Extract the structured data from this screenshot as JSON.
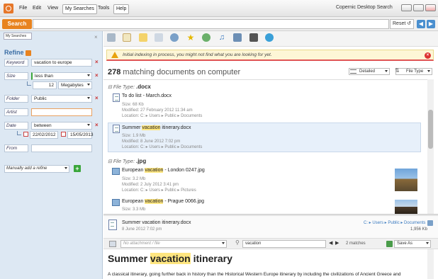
{
  "menu": {
    "file": "File",
    "edit": "Edit",
    "view": "View",
    "my_searches": "My Searches",
    "tools": "Tools",
    "help": "Help"
  },
  "app_title": "Copernic Desktop Search",
  "search": {
    "button": "Search",
    "query": "",
    "reset": "Reset"
  },
  "left": {
    "my_searches": "My Searches",
    "refine_title": "Refine",
    "filters": [
      {
        "label": "Keyword",
        "value": "vacation to europe"
      },
      {
        "label": "Size",
        "op": "less than",
        "num": "12",
        "unit": "Megabytes"
      },
      {
        "label": "Folder",
        "value": "Public"
      },
      {
        "label": "Artist",
        "value": ""
      },
      {
        "label": "Date",
        "op": "between",
        "from": "22/02/2012",
        "to": "15/05/2013"
      },
      {
        "label": "From",
        "value": ""
      }
    ],
    "manual": "Manually add a refine"
  },
  "warning": "Initial indexing in process, you might not find what you are looking for yet.",
  "results": {
    "count": "278",
    "count_label": "matching documents on computer",
    "view": "Detailed",
    "sort": "File Type",
    "groups": [
      {
        "label": "File Type:",
        "value": ".docx"
      },
      {
        "label": "File Type:",
        "value": ".jpg"
      }
    ],
    "items": [
      {
        "title": "To do list - March.docx",
        "size": "Size: 68 Kb",
        "modified": "Modified: 27 February 2012 11:34 am",
        "location": "Location: C: ▸ Users ▸ Public ▸ Documents"
      },
      {
        "title_pre": "Summer ",
        "title_hl": "vacation",
        "title_post": " itinerary.docx",
        "size": "Size: 1.9 Mb",
        "modified": "Modified: 8 June 2012 7:02 pm",
        "location": "Location: C: ▸ Users ▸ Public ▸ Documents"
      },
      {
        "title_pre": "European ",
        "title_hl": "vacation",
        "title_post": " - London 0247.jpg",
        "size": "Size: 3.2 Mb",
        "modified": "Modified: 2 July 2012 3:41 pm",
        "location": "Location: C: ▸ Users ▸ Public ▸ Pictures"
      },
      {
        "title_pre": "European ",
        "title_hl": "vacation",
        "title_post": " - Prague 0066.jpg",
        "size": "Size: 3.3 Mb",
        "modified": "",
        "location": ""
      }
    ]
  },
  "preview": {
    "file": "Summer vacation itinerary.docx",
    "date": "8 June 2012 7:02 pm",
    "path": "C: ▸ Users ▸ Public ▸ Documents",
    "size": "1,956 Kb",
    "attachment": "No attachment / file",
    "find": "vacation",
    "matches": "2 matches",
    "save_as": "Save As",
    "title_pre": "Summer ",
    "title_hl": "vacation",
    "title_post": " itinerary",
    "text": "A classical itinerary, going further back in history than the Historical Western Europe itinerary by including the civilizations of Ancient Greece and"
  }
}
